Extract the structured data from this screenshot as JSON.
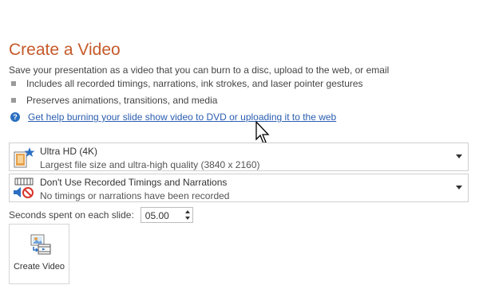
{
  "page": {
    "title": "Create a Video",
    "subtitle": "Save your presentation as a video that you can burn to a disc, upload to the web, or email",
    "bullets": [
      "Includes all recorded timings, narrations, ink strokes, and laser pointer gestures",
      "Preserves animations, transitions, and media"
    ],
    "help_link": "Get help burning your slide show video to DVD or uploading it to the web"
  },
  "quality_dropdown": {
    "title": "Ultra HD (4K)",
    "description": "Largest file size and ultra-high quality (3840 x 2160)",
    "icon": "ultra-hd-icon"
  },
  "timings_dropdown": {
    "title": "Don't Use Recorded Timings and Narrations",
    "description": "No timings or narrations have been recorded",
    "icon": "no-narration-icon"
  },
  "seconds": {
    "label": "Seconds spent on each slide:",
    "value": "05.00"
  },
  "create_button": {
    "label": "Create Video",
    "icon": "create-video-icon"
  },
  "colors": {
    "title": "#c55a2b",
    "link": "#2a5db0",
    "help_icon": "#2b6fc2",
    "star": "#2b6fc2",
    "no_symbol": "#d9342b"
  }
}
